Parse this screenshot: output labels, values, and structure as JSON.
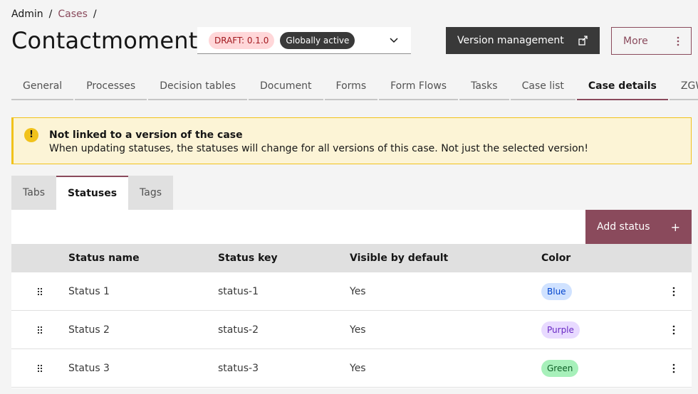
{
  "breadcrumb": {
    "root": "Admin",
    "cases": "Cases",
    "sep": "/"
  },
  "page_title": "Contactmoment",
  "version_select": {
    "draft_tag": "DRAFT: 0.1.0",
    "active_tag": "Globally active"
  },
  "buttons": {
    "version_management": "Version management",
    "more": "More",
    "add_status": "Add status",
    "add_icon": "+"
  },
  "main_tabs": [
    "General",
    "Processes",
    "Decision tables",
    "Document",
    "Forms",
    "Form Flows",
    "Tasks",
    "Case list",
    "Case details",
    "ZGW"
  ],
  "active_main_tab": "Case details",
  "notice": {
    "icon": "!",
    "title": "Not linked to a version of the case",
    "subtitle": "When updating statuses, the statuses will change for all versions of this case. Not just the selected version!"
  },
  "sub_tabs": [
    "Tabs",
    "Statuses",
    "Tags"
  ],
  "active_sub_tab": "Statuses",
  "table": {
    "headers": {
      "name": "Status name",
      "key": "Status key",
      "visible": "Visible by default",
      "color": "Color"
    },
    "rows": [
      {
        "name": "Status 1",
        "key": "status-1",
        "visible": "Yes",
        "color": "Blue"
      },
      {
        "name": "Status 2",
        "key": "status-2",
        "visible": "Yes",
        "color": "Purple"
      },
      {
        "name": "Status 3",
        "key": "status-3",
        "visible": "Yes",
        "color": "Green"
      }
    ]
  },
  "colors": {
    "accent": "#8a4a5c",
    "dark_button": "#393939",
    "warning": "#f1c21b",
    "warning_bg": "#fcf4d6"
  }
}
